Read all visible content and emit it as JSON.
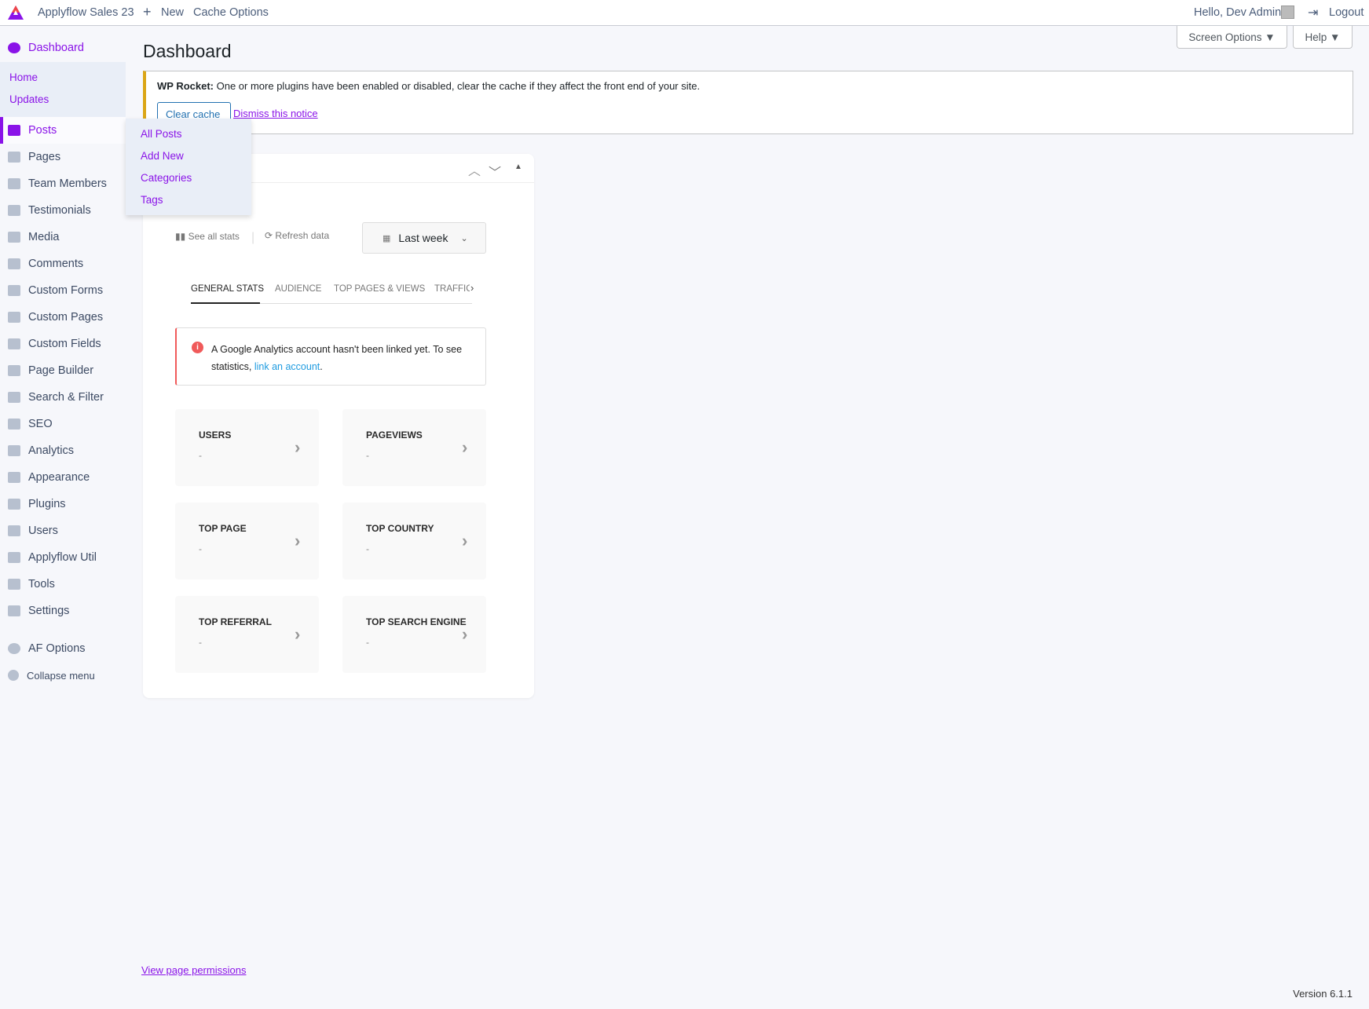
{
  "topbar": {
    "site": "Applyflow Sales 23",
    "new": "New",
    "cache": "Cache Options",
    "greeting": "Hello, Dev Admin",
    "logout": "Logout"
  },
  "sidebar": {
    "dashboard": "Dashboard",
    "sub": [
      "Home",
      "Updates"
    ],
    "items": [
      "Posts",
      "Pages",
      "Team Members",
      "Testimonials",
      "Media",
      "Comments",
      "Custom Forms",
      "Custom Pages",
      "Custom Fields",
      "Page Builder",
      "Search & Filter",
      "SEO",
      "Analytics",
      "Appearance",
      "Plugins",
      "Users",
      "Applyflow Util",
      "Tools",
      "Settings"
    ],
    "af_options": "AF Options",
    "collapse": "Collapse menu"
  },
  "flyout": [
    "All Posts",
    "Add New",
    "Categories",
    "Tags"
  ],
  "header": {
    "title": "Dashboard",
    "screen_options": "Screen Options ▼",
    "help": "Help ▼"
  },
  "notice": {
    "bold": "WP Rocket:",
    "text": " One or more plugins have been enabled or disabled, clear the cache if they affect the front end of your site.",
    "clear": "Clear cache",
    "dismiss": "Dismiss this notice"
  },
  "widget": {
    "see_all": "See all stats",
    "refresh": "Refresh data",
    "range": "Last week",
    "tabs": [
      "GENERAL STATS",
      "AUDIENCE",
      "TOP PAGES & VIEWS",
      "TRAFFIC"
    ],
    "alert": {
      "text": "A Google Analytics account hasn't been linked yet. To see statistics, ",
      "link": "link an account",
      "end": "."
    },
    "cards": [
      {
        "title": "USERS",
        "value": "-"
      },
      {
        "title": "PAGEVIEWS",
        "value": "-"
      },
      {
        "title": "TOP PAGE",
        "value": "-"
      },
      {
        "title": "TOP COUNTRY",
        "value": "-"
      },
      {
        "title": "TOP REFERRAL",
        "value": "-"
      },
      {
        "title": "TOP SEARCH ENGINE",
        "value": "-"
      }
    ]
  },
  "footer": {
    "permissions": "View page permissions",
    "version": "Version 6.1.1"
  },
  "colors": {
    "accent": "#8a13e8",
    "notice": "#dba617",
    "alert": "#f05a5a",
    "link": "#1e9be0"
  }
}
